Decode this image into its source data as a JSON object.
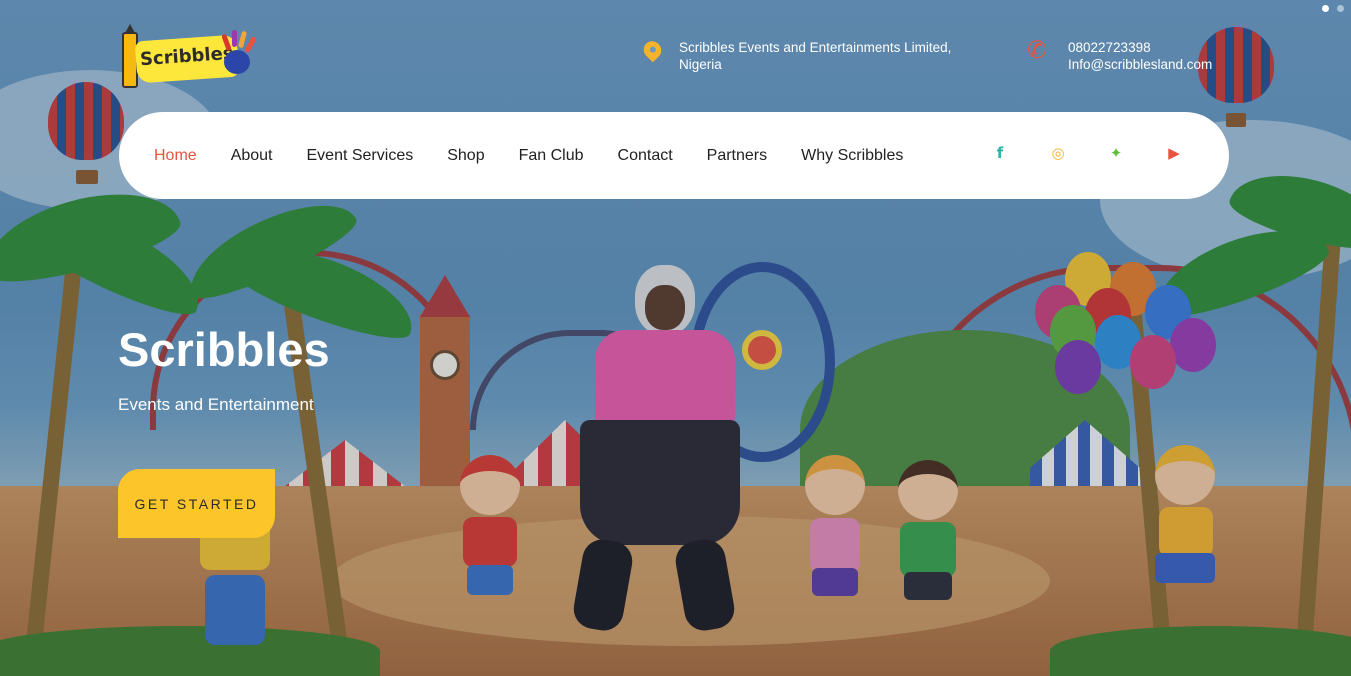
{
  "header": {
    "logo_text": "Scribbles",
    "address": "Scribbles Events and Entertainments Limited, Nigeria",
    "phone": "08022723398",
    "email": "Info@scribblesland.com"
  },
  "nav": {
    "items": [
      {
        "label": "Home",
        "active": true
      },
      {
        "label": "About"
      },
      {
        "label": "Event Services"
      },
      {
        "label": "Shop"
      },
      {
        "label": "Fan Club"
      },
      {
        "label": "Contact"
      },
      {
        "label": "Partners"
      },
      {
        "label": "Why Scribbles"
      }
    ],
    "social": [
      {
        "icon": "facebook-icon",
        "glyph": "f",
        "color": "#2ab5a5"
      },
      {
        "icon": "instagram-icon",
        "glyph": "◎",
        "color": "#f5b22b"
      },
      {
        "icon": "twitter-icon",
        "glyph": "✦",
        "color": "#5fbf3a"
      },
      {
        "icon": "youtube-icon",
        "glyph": "▶",
        "color": "#e8523e"
      }
    ]
  },
  "hero": {
    "title": "Scribbles",
    "subtitle": "Events and Entertainment",
    "cta_label": "GET STARTED"
  },
  "slider": {
    "dots": 2,
    "active": 1
  },
  "colors": {
    "accent": "#e8523e",
    "cta": "#fcc62a",
    "pin": "#f5b22b"
  }
}
